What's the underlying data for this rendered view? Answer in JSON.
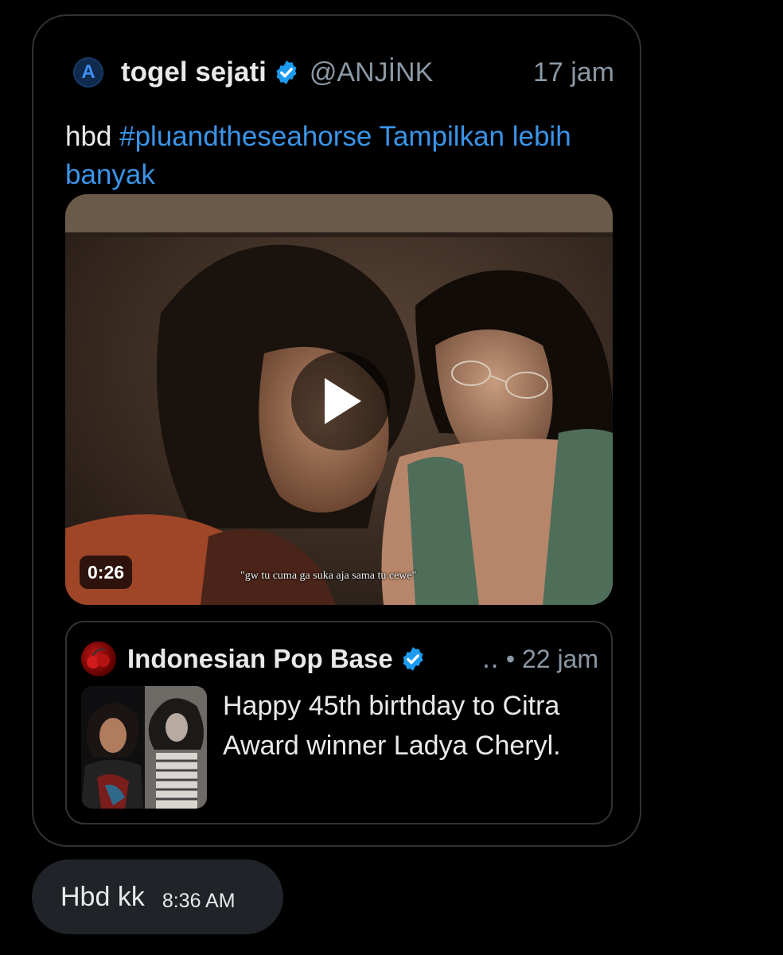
{
  "post": {
    "avatar_letter": "A",
    "author_name": "togel sejati",
    "handle": "@ANJİNK",
    "time": "17 jam",
    "text_prefix": "hbd ",
    "hashtag": "#pluandtheseahorse",
    "show_more": "Tampilkan lebih banyak"
  },
  "video": {
    "duration": "0:26",
    "subtitle": "\"gw tu cuma ga suka aja sama tu cewe\""
  },
  "quote": {
    "author_name": "Indonesian Pop Base",
    "meta": "‥ • 22 jam",
    "text": "Happy 45th birthday to Citra Award winner Ladya Cheryl."
  },
  "reply": {
    "text": "Hbd kk",
    "time": "8:36 AM"
  },
  "colors": {
    "background": "#000000",
    "link_blue": "#3a94e8",
    "verified_blue": "#1d9bf0",
    "muted_gray": "#8b98a5",
    "border": "#2f3336",
    "reply_bubble": "#202327"
  },
  "icons": [
    "verified-badge-icon",
    "play-icon"
  ]
}
